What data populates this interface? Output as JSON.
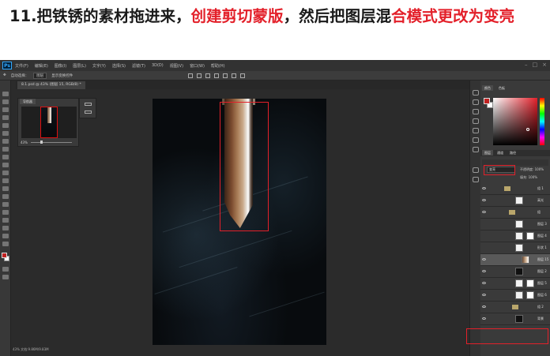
{
  "caption": {
    "part1": "11.把铁锈的素材拖进来，",
    "highlight1": "创建剪切蒙版",
    "part2": "，然后把图层混",
    "highlight2": "合模式更改为变亮"
  },
  "app": {
    "logo": "Ps"
  },
  "menu": [
    "文件(F)",
    "编辑(E)",
    "图像(I)",
    "图层(L)",
    "文字(Y)",
    "选择(S)",
    "滤镜(T)",
    "3D(D)",
    "视图(V)",
    "窗口(W)",
    "帮助(H)"
  ],
  "options_bar": {
    "auto_select": "自动选择：",
    "target": "图层",
    "transform": "显示变换控件"
  },
  "document": {
    "tab_label": "8.1.psd @ 43% (图层 15, RGB/8) *",
    "zoom": "43%",
    "status": "文档:9.86M/9.83M"
  },
  "navigator": {
    "title": "导航器",
    "zoom": "43%"
  },
  "right_panel": {
    "tab_color": "颜色",
    "tab_swatch": "色板",
    "layer_tabs": [
      "图层",
      "通道",
      "路径"
    ],
    "blend_mode": "变亮",
    "opacity_label": "不透明度: 100%",
    "fill_label": "填充: 100%"
  },
  "layers": [
    {
      "name": "组 1",
      "type": "folder"
    },
    {
      "name": "高光",
      "type": "layer"
    },
    {
      "name": "组",
      "type": "folder"
    },
    {
      "name": "图层 3",
      "type": "layer"
    },
    {
      "name": "图层 4",
      "type": "layer"
    },
    {
      "name": "形状 1",
      "type": "layer"
    },
    {
      "name": "图层 15",
      "type": "selected"
    },
    {
      "name": "图层 2",
      "type": "layer"
    },
    {
      "name": "图层 5",
      "type": "layer"
    },
    {
      "name": "图层 6",
      "type": "layer"
    },
    {
      "name": "组 2",
      "type": "folder"
    },
    {
      "name": "背景",
      "type": "layer"
    }
  ],
  "colors": {
    "accent_red": "#e3202a",
    "foreground": "#c12222",
    "panel": "#3a3a3a"
  }
}
